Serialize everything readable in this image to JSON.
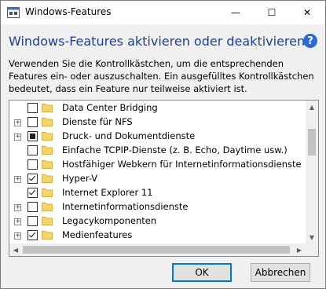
{
  "window": {
    "title": "Windows-Features",
    "heading": "Windows-Features aktivieren oder deaktivieren",
    "help_icon_glyph": "?",
    "description": "Verwenden Sie die Kontrollkästchen, um die entsprechenden Features ein- oder auszuschalten. Ein ausgefülltes Kontrollkästchen bedeutet, dass ein Feature nur teilweise aktiviert ist."
  },
  "titlebar_buttons": {
    "minimize_glyph": "—",
    "maximize_glyph": "☐",
    "close_glyph": "✕"
  },
  "features": [
    {
      "label": "Data Center Bridging",
      "expandable": false,
      "state": "unchecked"
    },
    {
      "label": "Dienste für NFS",
      "expandable": true,
      "state": "unchecked"
    },
    {
      "label": "Druck- und Dokumentdienste",
      "expandable": true,
      "state": "partial"
    },
    {
      "label": "Einfache TCPIP-Dienste (z. B. Echo, Daytime usw.)",
      "expandable": false,
      "state": "unchecked"
    },
    {
      "label": "Hostfähiger Webkern für Internetinformationsdienste",
      "expandable": false,
      "state": "unchecked"
    },
    {
      "label": "Hyper-V",
      "expandable": true,
      "state": "checked"
    },
    {
      "label": "Internet Explorer 11",
      "expandable": false,
      "state": "checked"
    },
    {
      "label": "Internetinformationsdienste",
      "expandable": true,
      "state": "unchecked"
    },
    {
      "label": "Legacykomponenten",
      "expandable": true,
      "state": "unchecked"
    },
    {
      "label": "Medienfeatures",
      "expandable": true,
      "state": "checked"
    }
  ],
  "buttons": {
    "ok": "OK",
    "cancel": "Abbrechen"
  },
  "colors": {
    "heading": "#1a3e9c",
    "folder": "#f5d56a",
    "accent": "#0078d7"
  }
}
